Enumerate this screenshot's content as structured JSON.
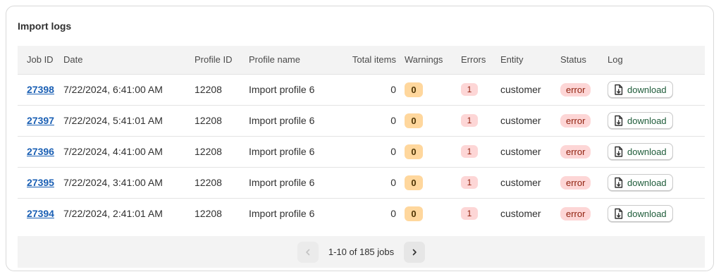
{
  "card": {
    "title": "Import logs"
  },
  "table": {
    "headers": {
      "job_id": "Job ID",
      "date": "Date",
      "profile_id": "Profile ID",
      "profile_name": "Profile name",
      "total_items": "Total items",
      "warnings": "Warnings",
      "errors": "Errors",
      "entity": "Entity",
      "status": "Status",
      "log": "Log"
    },
    "rows": [
      {
        "job_id": "27398",
        "date": "7/22/2024, 6:41:00 AM",
        "profile_id": "12208",
        "profile_name": "Import profile 6",
        "total_items": "0",
        "warnings": "0",
        "errors": "1",
        "entity": "customer",
        "status": "error",
        "log": "download"
      },
      {
        "job_id": "27397",
        "date": "7/22/2024, 5:41:01 AM",
        "profile_id": "12208",
        "profile_name": "Import profile 6",
        "total_items": "0",
        "warnings": "0",
        "errors": "1",
        "entity": "customer",
        "status": "error",
        "log": "download"
      },
      {
        "job_id": "27396",
        "date": "7/22/2024, 4:41:00 AM",
        "profile_id": "12208",
        "profile_name": "Import profile 6",
        "total_items": "0",
        "warnings": "0",
        "errors": "1",
        "entity": "customer",
        "status": "error",
        "log": "download"
      },
      {
        "job_id": "27395",
        "date": "7/22/2024, 3:41:00 AM",
        "profile_id": "12208",
        "profile_name": "Import profile 6",
        "total_items": "0",
        "warnings": "0",
        "errors": "1",
        "entity": "customer",
        "status": "error",
        "log": "download"
      },
      {
        "job_id": "27394",
        "date": "7/22/2024, 2:41:01 AM",
        "profile_id": "12208",
        "profile_name": "Import profile 6",
        "total_items": "0",
        "warnings": "0",
        "errors": "1",
        "entity": "customer",
        "status": "error",
        "log": "download"
      }
    ]
  },
  "pagination": {
    "label": "1-10 of 185 jobs",
    "prev_icon": "chevron-left-icon",
    "next_icon": "chevron-right-icon",
    "prev_disabled": true
  },
  "colors": {
    "link": "#1a5fb4",
    "warning_badge": "#ffd79d",
    "error_badge": "#fdd6d6",
    "download_text": "#1f5c3a"
  },
  "icons": {
    "download": "file-download-icon"
  }
}
